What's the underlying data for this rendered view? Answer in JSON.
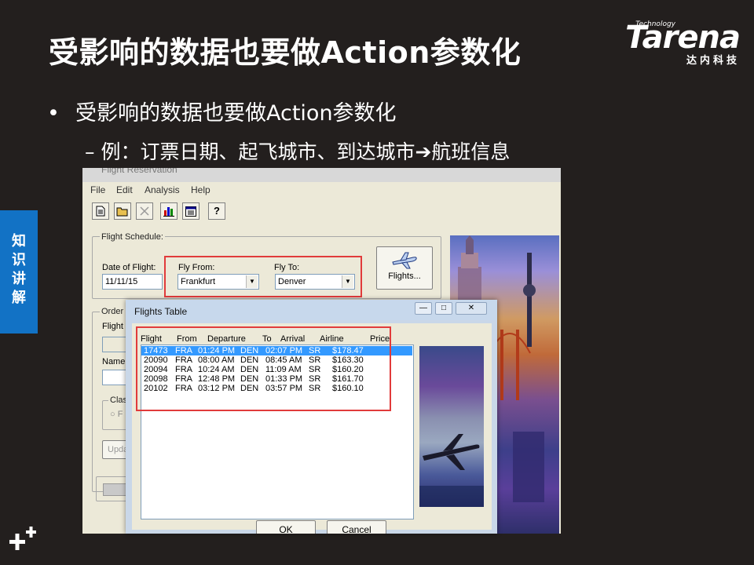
{
  "slide": {
    "title": "受影响的数据也要做Action参数化",
    "bullet1": "受影响的数据也要做Action参数化",
    "bullet2": "– 例：订票日期、起飞城市、到达城市➔航班信息",
    "side_tab": [
      "知",
      "识",
      "讲",
      "解"
    ],
    "logo": {
      "small": "Technology",
      "word": "Tarena",
      "cn": "达内科技"
    },
    "bullet_glyph": "•",
    "plus_glyph": "+⁺"
  },
  "app": {
    "title": "Flight Reservation",
    "menu": [
      "File",
      "Edit",
      "Analysis",
      "Help"
    ],
    "toolbar": [
      "new-order",
      "open-order",
      "delete-order",
      "graph",
      "report",
      "help"
    ],
    "toolbar_help_label": "?",
    "flight_schedule": {
      "group_label": "Flight Schedule:",
      "date_label": "Date of Flight:",
      "date_value": "11/11/15",
      "fly_from_label": "Fly From:",
      "fly_from_value": "Frankfurt",
      "fly_to_label": "Fly To:",
      "fly_to_value": "Denver",
      "flights_button": "Flights..."
    },
    "order_info": {
      "group_label_partial": "Order I",
      "flight_no_partial": "Flight N",
      "name_label": "Name:",
      "class_partial": "Class",
      "class_radio_partial": "F",
      "update_partial": "Upda"
    }
  },
  "dialog": {
    "title": "Flights Table",
    "columns": [
      "Flight",
      "From",
      "Departure",
      "To",
      "Arrival",
      "Airline",
      "Price"
    ],
    "rows": [
      [
        "17473",
        "FRA",
        "01:24 PM",
        "DEN",
        "02:07 PM",
        "SR",
        "$178.47"
      ],
      [
        "20090",
        "FRA",
        "08:00 AM",
        "DEN",
        "08:45 AM",
        "SR",
        "$163.30"
      ],
      [
        "20094",
        "FRA",
        "10:24 AM",
        "DEN",
        "11:09 AM",
        "SR",
        "$160.20"
      ],
      [
        "20098",
        "FRA",
        "12:48 PM",
        "DEN",
        "01:33 PM",
        "SR",
        "$161.70"
      ],
      [
        "20102",
        "FRA",
        "03:12 PM",
        "DEN",
        "03:57 PM",
        "SR",
        "$160.10"
      ]
    ],
    "selected_row": 0,
    "ok_label": "OK",
    "cancel_label": "Cancel"
  },
  "colors": {
    "background": "#231f1e",
    "side_tab": "#1272c5",
    "highlight_box": "#e13b3b",
    "selection": "#3399ff"
  }
}
